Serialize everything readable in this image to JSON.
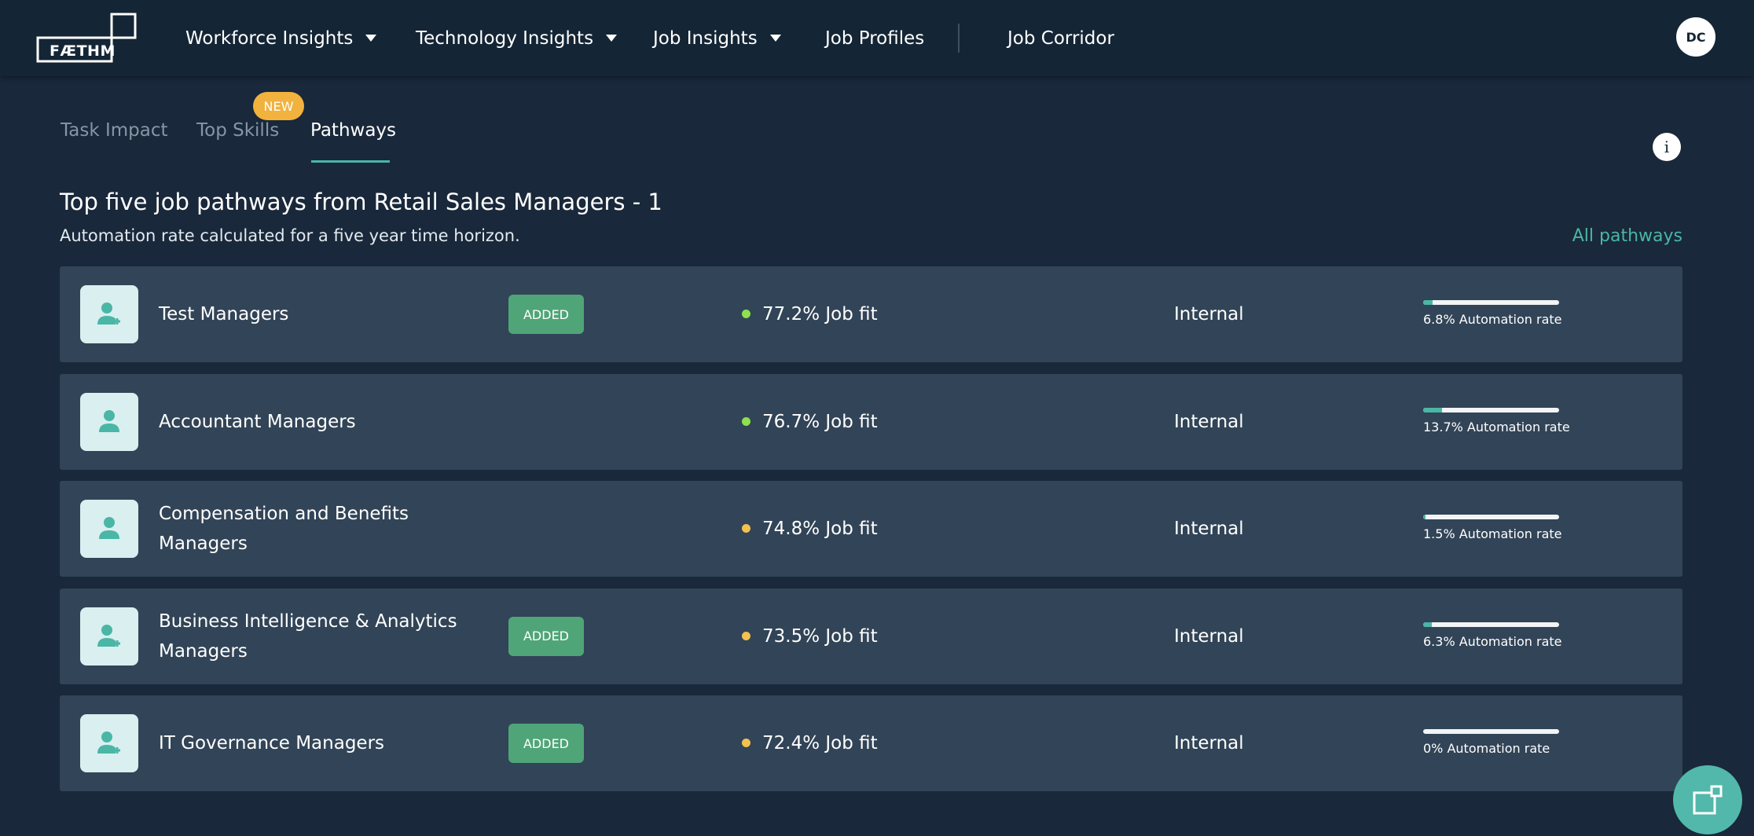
{
  "app": {
    "logo_text": "FÆTHM",
    "avatar_initials": "DC"
  },
  "nav": {
    "items": [
      {
        "label": "Workforce Insights",
        "has_dropdown": true
      },
      {
        "label": "Technology Insights",
        "has_dropdown": true
      },
      {
        "label": "Job Insights",
        "has_dropdown": true
      },
      {
        "label": "Job Profiles",
        "has_dropdown": false
      },
      {
        "label": "Job Corridor",
        "has_dropdown": false
      }
    ]
  },
  "tabs": {
    "items": [
      {
        "label": "Task Impact",
        "active": false
      },
      {
        "label": "Top Skills",
        "active": false,
        "badge": "NEW"
      },
      {
        "label": "Pathways",
        "active": true
      }
    ]
  },
  "main": {
    "title": "Top five job pathways from Retail Sales Managers - 1",
    "subtitle": "Automation rate calculated for a five year time horizon.",
    "all_pathways_label": "All pathways",
    "info_glyph": "i"
  },
  "pathways": [
    {
      "title": "Test Managers",
      "added": "ADDED",
      "fit": "77.2% Job fit",
      "fit_color": "#8ee04f",
      "source": "Internal",
      "automation_label": "6.8% Automation rate",
      "automation_pct": 6.8,
      "icon": "user-add-icon"
    },
    {
      "title": "Accountant Managers",
      "added": "",
      "fit": "76.7% Job fit",
      "fit_color": "#8ee04f",
      "source": "Internal",
      "automation_label": "13.7% Automation rate",
      "automation_pct": 13.7,
      "icon": "user-icon"
    },
    {
      "title": "Compensation and Benefits Managers",
      "added": "",
      "fit": "74.8% Job fit",
      "fit_color": "#f2c14e",
      "source": "Internal",
      "automation_label": "1.5% Automation rate",
      "automation_pct": 1.5,
      "icon": "user-icon"
    },
    {
      "title": "Business Intelligence & Analytics Managers",
      "added": "ADDED",
      "fit": "73.5% Job fit",
      "fit_color": "#f2c14e",
      "source": "Internal",
      "automation_label": "6.3% Automation rate",
      "automation_pct": 6.3,
      "icon": "user-add-icon"
    },
    {
      "title": "IT Governance Managers",
      "added": "ADDED",
      "fit": "72.4% Job fit",
      "fit_color": "#f2c14e",
      "source": "Internal",
      "automation_label": "0% Automation rate",
      "automation_pct": 0,
      "icon": "user-add-icon"
    }
  ],
  "colors": {
    "accent": "#4ab6a6",
    "added_badge": "#4fa577",
    "new_badge": "#f2b23e"
  }
}
